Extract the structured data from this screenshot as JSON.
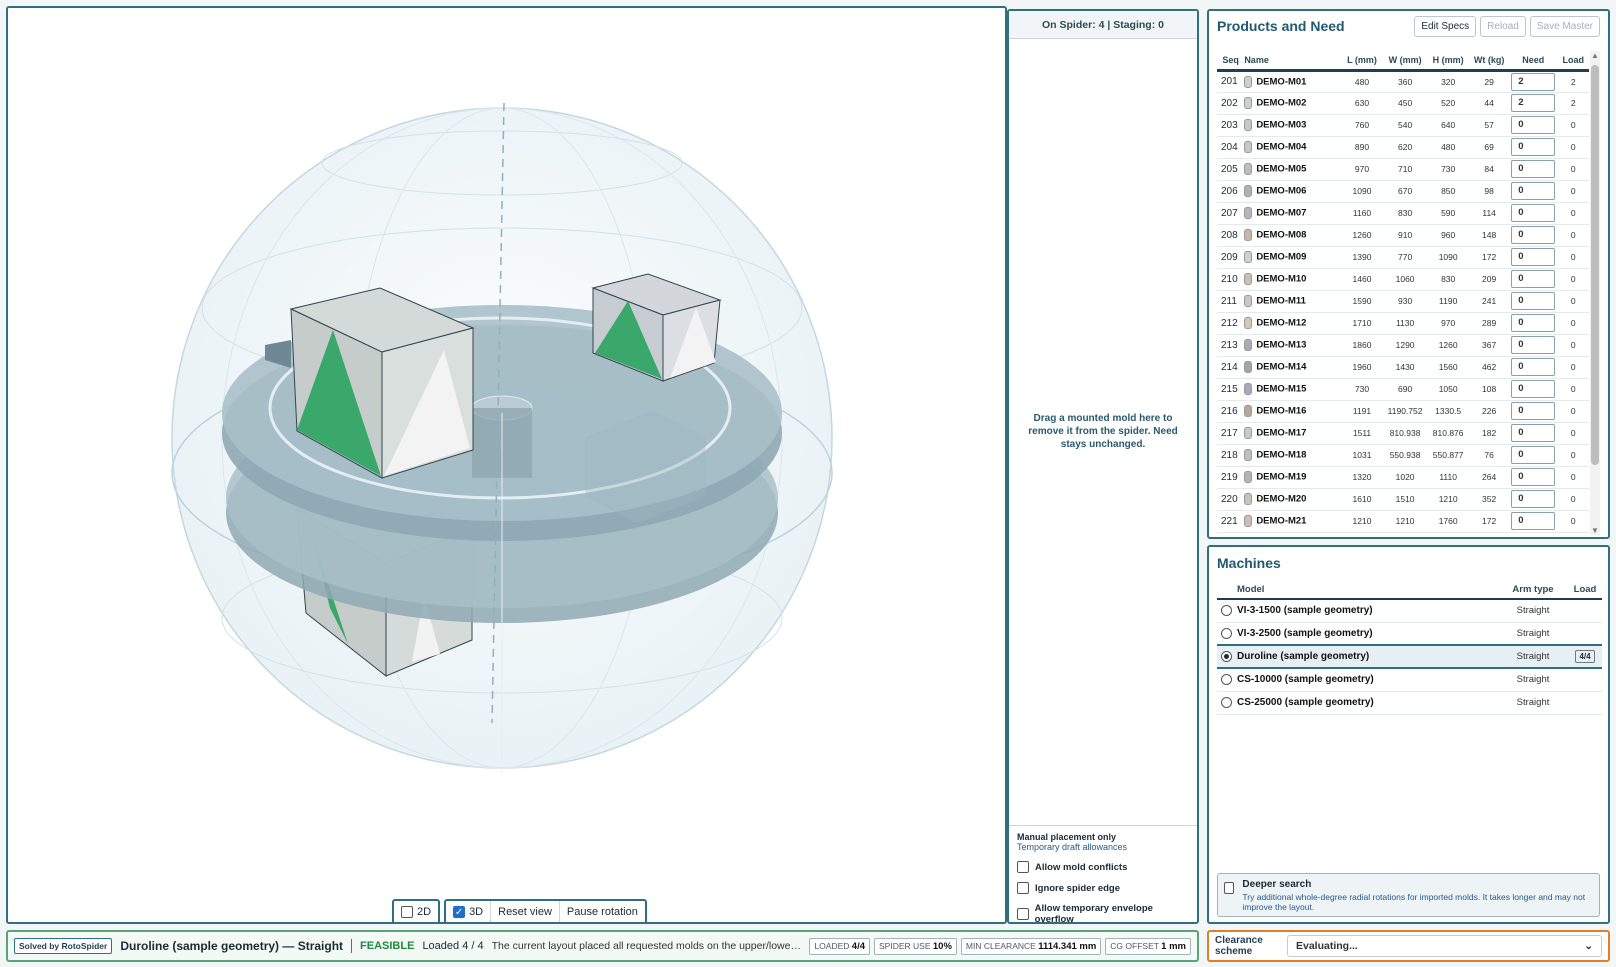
{
  "view_toolbar": {
    "mode_2d": "2D",
    "mode_3d": "3D",
    "reset_view": "Reset view",
    "pause_rotation": "Pause rotation"
  },
  "staging": {
    "header": "On Spider: 4 | Staging: 0",
    "drop_hint": "Drag a mounted mold here to remove it from the spider. Need stays unchanged.",
    "note_manual": "Manual placement only",
    "note_draft": "Temporary draft allowances",
    "option_conflicts": "Allow mold conflicts",
    "option_edge": "Ignore spider edge",
    "option_overflow": "Allow temporary envelope overflow"
  },
  "products": {
    "title": "Products and Need",
    "edit_specs": "Edit Specs",
    "reload": "Reload",
    "save_master": "Save Master",
    "columns": [
      "Seq",
      "Name",
      "L (mm)",
      "W (mm)",
      "H (mm)",
      "Wt (kg)",
      "Need",
      "Load"
    ],
    "rows": [
      {
        "seq": "201",
        "name": "DEMO-M01",
        "l": "480",
        "w": "360",
        "h": "320",
        "wt": "29",
        "need": "2",
        "load": "2",
        "color": "#c9d3c9"
      },
      {
        "seq": "202",
        "name": "DEMO-M02",
        "l": "630",
        "w": "450",
        "h": "520",
        "wt": "44",
        "need": "2",
        "load": "2",
        "color": "#c9cfd3"
      },
      {
        "seq": "203",
        "name": "DEMO-M03",
        "l": "760",
        "w": "540",
        "h": "640",
        "wt": "57",
        "need": "0",
        "load": "0",
        "color": "#c8c8c8"
      },
      {
        "seq": "204",
        "name": "DEMO-M04",
        "l": "890",
        "w": "620",
        "h": "480",
        "wt": "69",
        "need": "0",
        "load": "0",
        "color": "#c2c8cc"
      },
      {
        "seq": "205",
        "name": "DEMO-M05",
        "l": "970",
        "w": "710",
        "h": "730",
        "wt": "84",
        "need": "0",
        "load": "0",
        "color": "#b8bfc4"
      },
      {
        "seq": "206",
        "name": "DEMO-M06",
        "l": "1090",
        "w": "670",
        "h": "850",
        "wt": "98",
        "need": "0",
        "load": "0",
        "color": "#adb4b8"
      },
      {
        "seq": "207",
        "name": "DEMO-M07",
        "l": "1160",
        "w": "830",
        "h": "590",
        "wt": "114",
        "need": "0",
        "load": "0",
        "color": "#b9b2c2"
      },
      {
        "seq": "208",
        "name": "DEMO-M08",
        "l": "1260",
        "w": "910",
        "h": "960",
        "wt": "148",
        "need": "0",
        "load": "0",
        "color": "#c4b9a4"
      },
      {
        "seq": "209",
        "name": "DEMO-M09",
        "l": "1390",
        "w": "770",
        "h": "1090",
        "wt": "172",
        "need": "0",
        "load": "0",
        "color": "#d0d2c8"
      },
      {
        "seq": "210",
        "name": "DEMO-M10",
        "l": "1460",
        "w": "1060",
        "h": "830",
        "wt": "209",
        "need": "0",
        "load": "0",
        "color": "#c9c1b4"
      },
      {
        "seq": "211",
        "name": "DEMO-M11",
        "l": "1590",
        "w": "930",
        "h": "1190",
        "wt": "241",
        "need": "0",
        "load": "0",
        "color": "#d3c4c4"
      },
      {
        "seq": "212",
        "name": "DEMO-M12",
        "l": "1710",
        "w": "1130",
        "h": "970",
        "wt": "289",
        "need": "0",
        "load": "0",
        "color": "#d6c8b0"
      },
      {
        "seq": "213",
        "name": "DEMO-M13",
        "l": "1860",
        "w": "1290",
        "h": "1260",
        "wt": "367",
        "need": "0",
        "load": "0",
        "color": "#a9a9b8"
      },
      {
        "seq": "214",
        "name": "DEMO-M14",
        "l": "1960",
        "w": "1430",
        "h": "1560",
        "wt": "462",
        "need": "0",
        "load": "0",
        "color": "#9ea8a4"
      },
      {
        "seq": "215",
        "name": "DEMO-M15",
        "l": "730",
        "w": "690",
        "h": "1050",
        "wt": "108",
        "need": "0",
        "load": "0",
        "color": "#b0a4bc"
      },
      {
        "seq": "216",
        "name": "DEMO-M16",
        "l": "1191",
        "w": "1190.752",
        "h": "1330.5",
        "wt": "226",
        "need": "0",
        "load": "0",
        "color": "#b4a89c"
      },
      {
        "seq": "217",
        "name": "DEMO-M17",
        "l": "1511",
        "w": "810.938",
        "h": "810.876",
        "wt": "182",
        "need": "0",
        "load": "0",
        "color": "#c4ccc4"
      },
      {
        "seq": "218",
        "name": "DEMO-M18",
        "l": "1031",
        "w": "550.938",
        "h": "550.877",
        "wt": "76",
        "need": "0",
        "load": "0",
        "color": "#b8c0c4"
      },
      {
        "seq": "219",
        "name": "DEMO-M19",
        "l": "1320",
        "w": "1020",
        "h": "1110",
        "wt": "264",
        "need": "0",
        "load": "0",
        "color": "#bdb0b8"
      },
      {
        "seq": "220",
        "name": "DEMO-M20",
        "l": "1610",
        "w": "1510",
        "h": "1210",
        "wt": "352",
        "need": "0",
        "load": "0",
        "color": "#c6c6b8"
      },
      {
        "seq": "221",
        "name": "DEMO-M21",
        "l": "1210",
        "w": "1210",
        "h": "1760",
        "wt": "172",
        "need": "0",
        "load": "0",
        "color": "#cdbfb5"
      }
    ]
  },
  "machines": {
    "title": "Machines",
    "columns": [
      "Model",
      "Arm type",
      "Load"
    ],
    "rows": [
      {
        "model": "VI-3-1500 (sample geometry)",
        "arm": "Straight",
        "load": "",
        "selected": false
      },
      {
        "model": "VI-3-2500 (sample geometry)",
        "arm": "Straight",
        "load": "",
        "selected": false
      },
      {
        "model": "Duroline (sample geometry)",
        "arm": "Straight",
        "load": "4/4",
        "selected": true
      },
      {
        "model": "CS-10000 (sample geometry)",
        "arm": "Straight",
        "load": "",
        "selected": false
      },
      {
        "model": "CS-25000 (sample geometry)",
        "arm": "Straight",
        "load": "",
        "selected": false
      }
    ],
    "deeper_title": "Deeper search",
    "deeper_desc": "Try additional whole-degree radial rotations for imported molds. It takes longer and may not improve the layout."
  },
  "status": {
    "solved_by": "Solved by RotoSpider",
    "title": "Duroline (sample geometry) — Straight",
    "feasible": "FEASIBLE",
    "loaded": "Loaded 4 / 4",
    "message": "The current layout placed all requested molds on the upper/lower spiders...",
    "pills": [
      {
        "label": "LOADED",
        "value": "4/4"
      },
      {
        "label": "SPIDER USE",
        "value": "10%"
      },
      {
        "label": "MIN CLEARANCE",
        "value": "1114.341 mm"
      },
      {
        "label": "CG OFFSET",
        "value": "1 mm"
      }
    ]
  },
  "clearance": {
    "label": "Clearance scheme",
    "value": "Evaluating..."
  },
  "colors": {
    "accent": "#2f6f80",
    "feasible": "#1f8a3c",
    "mold_green": "#3aa86b",
    "spider": "#8fa9b4"
  }
}
